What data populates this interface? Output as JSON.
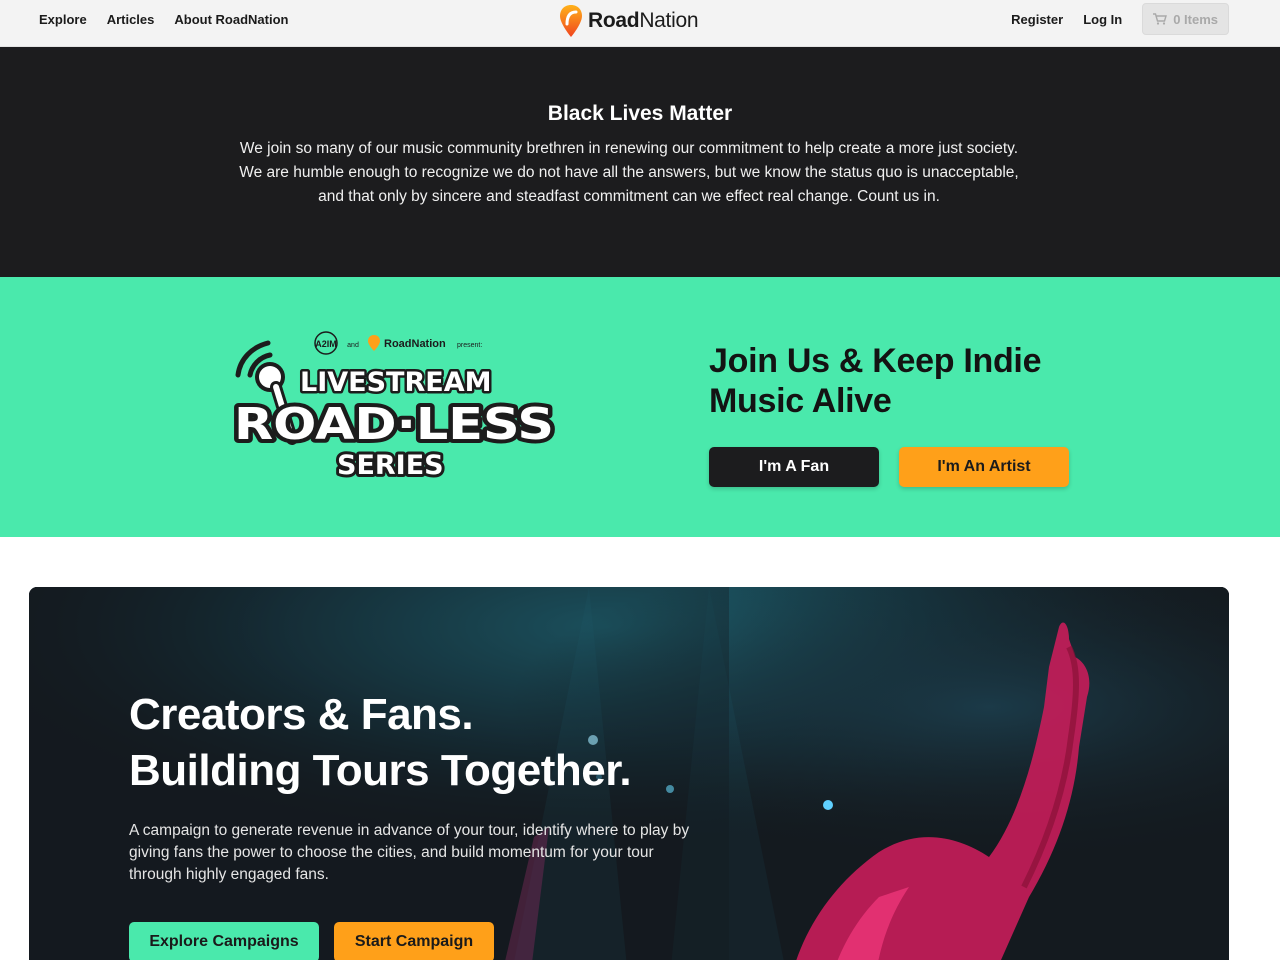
{
  "nav": {
    "links": [
      "Explore",
      "Articles",
      "About RoadNation"
    ],
    "brand_bold": "Road",
    "brand_rest": "Nation",
    "register": "Register",
    "login": "Log In",
    "cart_label": "0 Items"
  },
  "blm": {
    "title": "Black Lives Matter",
    "text": "We join so many of our music community brethren in renewing our commitment to help create a more just society. We are humble enough to recognize we do not have all the answers, but we know the status quo is unacceptable, and that only by sincere and steadfast commitment can we effect real change. Count us in."
  },
  "promo": {
    "logo": {
      "presenter_1": "A2IM",
      "and": "and",
      "presenter_2": "RoadNation",
      "present": "present:",
      "line_1": "LIVESTREAM",
      "line_2": "ROAD·LESS",
      "line_3": "SERIES"
    },
    "title": "Join Us & Keep Indie Music Alive",
    "fan_button": "I'm A Fan",
    "artist_button": "I'm An Artist"
  },
  "hero": {
    "title_line_1": "Creators & Fans.",
    "title_line_2": "Building Tours Together.",
    "text": "A campaign to generate revenue in advance of your tour, identify where to play by giving fans the power to choose the cities, and build momentum for your tour through highly engaged fans.",
    "explore_button": "Explore Campaigns",
    "start_button": "Start Campaign"
  },
  "colors": {
    "green": "#4ae9ac",
    "orange": "#ffa019",
    "dark": "#1c1c1e"
  },
  "icons": [
    "roadnation-pin-icon",
    "cart-icon",
    "microphone-icon",
    "broadcast-waves-icon"
  ]
}
